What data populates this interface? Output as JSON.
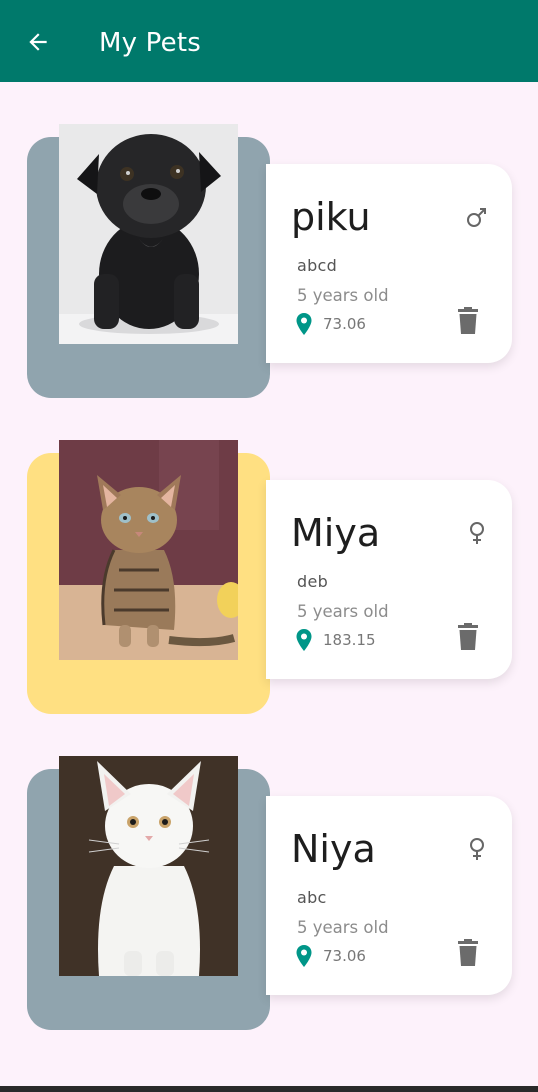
{
  "app_bar": {
    "title": "My Pets",
    "back_icon": "arrow-back-icon",
    "color": "#00796b"
  },
  "pets": [
    {
      "name": "piku",
      "breed": "abcd",
      "age": "5 years old",
      "distance": "73.06",
      "gender_icon": "male-icon",
      "card_color": "#90a4ae",
      "photo": "black pug puppy"
    },
    {
      "name": "Miya",
      "breed": "deb",
      "age": "5 years old",
      "distance": "183.15",
      "gender_icon": "female-icon",
      "card_color": "#ffe082",
      "photo": "tabby kitten"
    },
    {
      "name": "Niya",
      "breed": "abc",
      "age": "5 years old",
      "distance": "73.06",
      "gender_icon": "female-icon",
      "card_color": "#90a4ae",
      "photo": "white cat"
    }
  ],
  "accent_color": "#009688"
}
